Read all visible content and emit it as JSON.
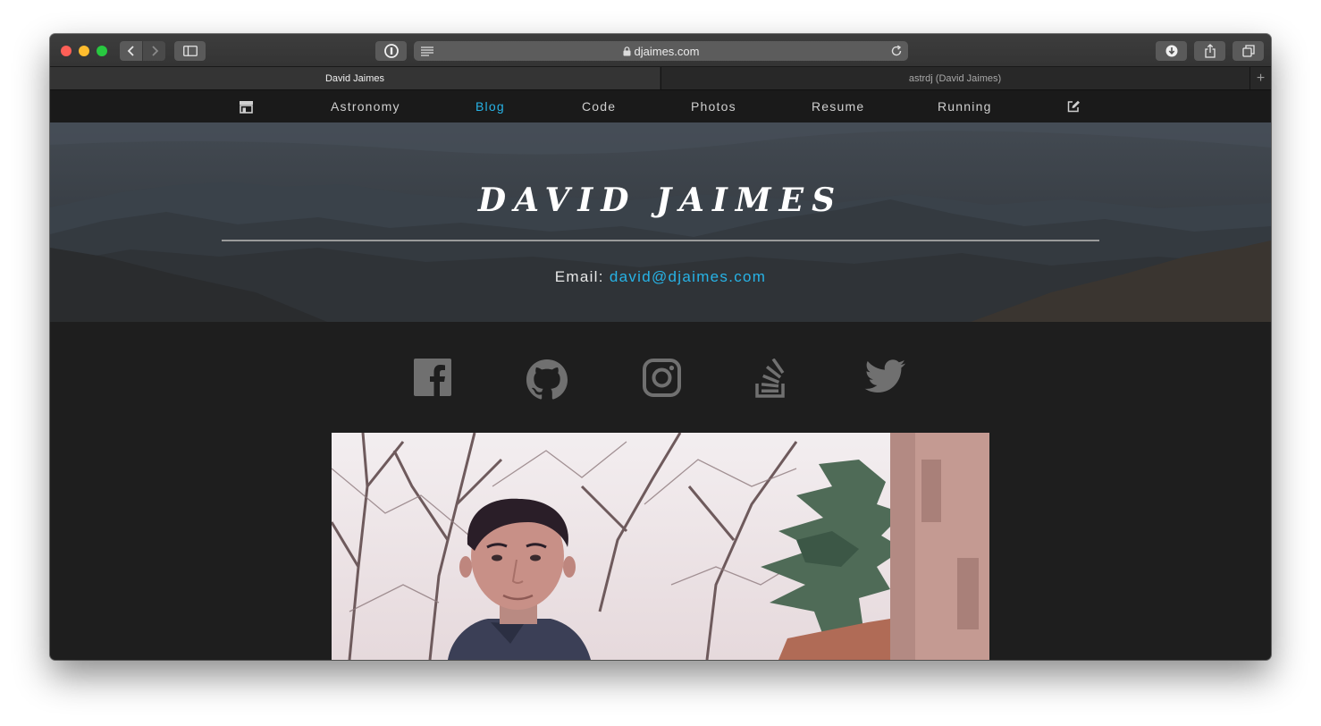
{
  "browser": {
    "url": "djaimes.com",
    "tabs": [
      {
        "label": "David Jaimes",
        "active": true
      },
      {
        "label": "astrdj (David Jaimes)",
        "active": false
      }
    ],
    "new_tab_label": "+"
  },
  "nav": {
    "items": [
      {
        "label": "Astronomy",
        "active": false
      },
      {
        "label": "Blog",
        "active": true
      },
      {
        "label": "Code",
        "active": false
      },
      {
        "label": "Photos",
        "active": false
      },
      {
        "label": "Resume",
        "active": false
      },
      {
        "label": "Running",
        "active": false
      }
    ],
    "icons": [
      "store-icon",
      "edit-icon"
    ]
  },
  "hero": {
    "title": "DAVID JAIMES",
    "email_label": "Email:",
    "email": "david@djaimes.com"
  },
  "social": [
    "facebook-icon",
    "github-icon",
    "instagram-icon",
    "stackoverflow-icon",
    "twitter-icon"
  ],
  "colors": {
    "accent": "#27b3e6",
    "page_bg": "#1e1e1e",
    "nav_bg": "#1a1a1a",
    "icon_gray": "#707070"
  }
}
